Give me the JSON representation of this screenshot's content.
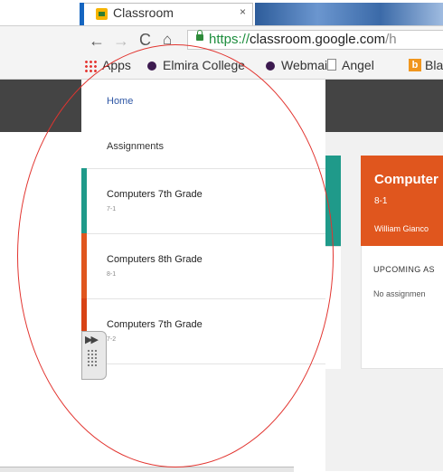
{
  "browser": {
    "tab_title": "Classroom",
    "tab_close": "×",
    "url_scheme": "https://",
    "url_host": "classroom.google.com",
    "url_path": "/h",
    "bookmarks": [
      "Apps",
      "Elmira College",
      "Webmail",
      "Angel",
      "Bla"
    ]
  },
  "drawer": {
    "home": "Home",
    "assignments": "Assignments",
    "classes": [
      {
        "name": "Computers 7th Grade",
        "section": "7-1",
        "color": "#1f9a8a"
      },
      {
        "name": "Computers 8th Grade",
        "section": "8-1",
        "color": "#e0561e"
      },
      {
        "name": "Computers 7th Grade",
        "section": "7-2",
        "color": "#d84315"
      }
    ]
  },
  "card": {
    "title": "Computer",
    "section": "8-1",
    "teacher": "William Gianco",
    "upcoming": "UPCOMING AS",
    "no_assignments": "No assignmen"
  },
  "colors": {
    "header": "#444444",
    "home_link": "#2f57a5",
    "annotation_circle": "#e2342f"
  }
}
